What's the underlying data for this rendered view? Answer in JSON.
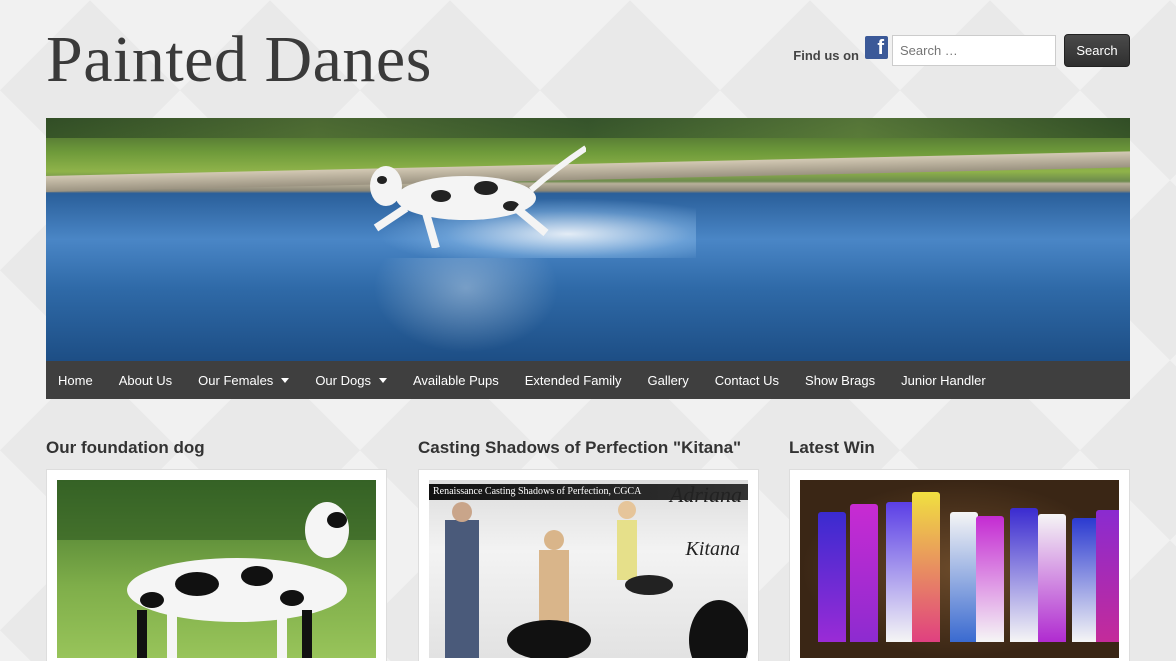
{
  "site": {
    "title": "Painted Danes"
  },
  "header": {
    "find_us": "Find us on",
    "facebook_icon": "facebook-icon",
    "search_placeholder": "Search …",
    "search_button": "Search"
  },
  "nav": {
    "items": [
      {
        "label": "Home",
        "dropdown": false
      },
      {
        "label": "About Us",
        "dropdown": false
      },
      {
        "label": "Our Females",
        "dropdown": true
      },
      {
        "label": "Our Dogs",
        "dropdown": true
      },
      {
        "label": "Available Pups",
        "dropdown": false
      },
      {
        "label": "Extended Family",
        "dropdown": false
      },
      {
        "label": "Gallery",
        "dropdown": false
      },
      {
        "label": "Contact Us",
        "dropdown": false
      },
      {
        "label": "Show Brags",
        "dropdown": false
      },
      {
        "label": "Junior Handler",
        "dropdown": false
      }
    ]
  },
  "columns": [
    {
      "title": "Our foundation dog"
    },
    {
      "title": "Casting Shadows of Perfection \"Kitana\"",
      "image_banner": "Renaissance Casting Shadows of Perfection, CGCA",
      "image_script_1": "Adriana",
      "image_script_2": "Kitana"
    },
    {
      "title": "Latest Win"
    }
  ],
  "colors": {
    "navbar": "#3f3f3f",
    "search_button": "#333333",
    "facebook": "#3b5998"
  }
}
